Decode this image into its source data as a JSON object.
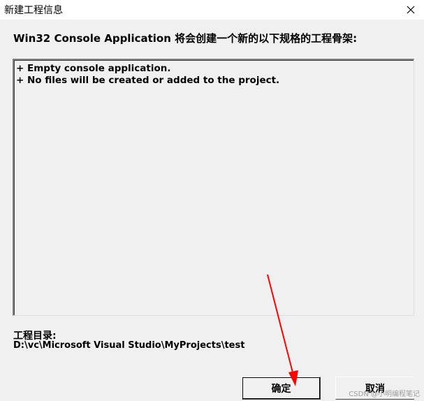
{
  "window": {
    "title": "新建工程信息"
  },
  "heading": "Win32 Console Application 将会创建一个新的以下规格的工程骨架:",
  "info_lines": [
    "+ Empty console application.",
    "+ No files will be created or added to the project."
  ],
  "directory": {
    "label": "工程目录:",
    "path": "D:\\vc\\Microsoft Visual Studio\\MyProjects\\test"
  },
  "buttons": {
    "ok_label": "确定",
    "cancel_label": "取消"
  },
  "watermark": "CSDN @小明编程笔记",
  "icons": {
    "close": "close-icon",
    "annotation": "red-arrow-icon"
  },
  "colors": {
    "annotation": "#ff0000",
    "dialog_background": "#f0f0f0"
  }
}
